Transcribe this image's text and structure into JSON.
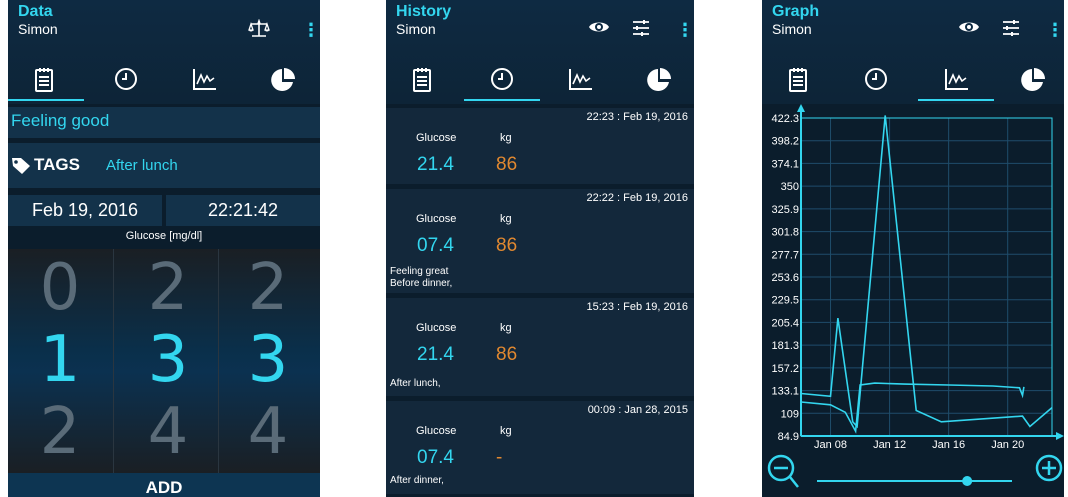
{
  "colors": {
    "accent": "#33d6ef",
    "weight": "#e08830",
    "bg": "#0b1d2c"
  },
  "screen_data": {
    "title": "Data",
    "user": "Simon",
    "actions": [
      "scale-icon",
      "more-vert-icon"
    ],
    "feeling": "Feeling good",
    "tags_label": "TAGS",
    "tags_value": "After lunch",
    "date": "Feb 19, 2016",
    "time": "22:21:42",
    "unit_label": "Glucose  [mg/dl]",
    "wheels": [
      {
        "above": "0",
        "selected": "1",
        "below": "2"
      },
      {
        "above": "2",
        "selected": "3",
        "below": "4"
      },
      {
        "above": "2",
        "selected": "3",
        "below": "4"
      }
    ],
    "add_label": "ADD"
  },
  "screen_history": {
    "title": "History",
    "user": "Simon",
    "actions": [
      "eye-icon",
      "filter-icon",
      "more-vert-icon"
    ],
    "entries": [
      {
        "timestamp": "22:23 : Feb 19, 2016",
        "glucose_label": "Glucose",
        "kg_label": "kg",
        "glucose": "21.4",
        "kg": "86",
        "notes": []
      },
      {
        "timestamp": "22:22 : Feb 19, 2016",
        "glucose_label": "Glucose",
        "kg_label": "kg",
        "glucose": "07.4",
        "kg": "86",
        "notes": [
          "Feeling great",
          "Before dinner,"
        ]
      },
      {
        "timestamp": "15:23 : Feb 19, 2016",
        "glucose_label": "Glucose",
        "kg_label": "kg",
        "glucose": "21.4",
        "kg": "86",
        "notes": [
          "After lunch,"
        ]
      },
      {
        "timestamp": "00:09 : Jan 28, 2015",
        "glucose_label": "Glucose",
        "kg_label": "kg",
        "glucose": "07.4",
        "kg": "-",
        "notes": [
          "After dinner,"
        ]
      }
    ]
  },
  "screen_graph": {
    "title": "Graph",
    "user": "Simon",
    "actions": [
      "eye-icon",
      "filter-icon",
      "more-vert-icon"
    ],
    "zoom": {
      "out_icon": "zoom-out-icon",
      "in_icon": "zoom-in-icon",
      "level": 0.77
    }
  },
  "tabs": [
    "notebook-icon",
    "clock-icon",
    "graph-icon",
    "pie-chart-icon"
  ],
  "chart_data": {
    "type": "line",
    "y_ticks": [
      "422.3",
      "398.2",
      "374.1",
      "350",
      "325.9",
      "301.8",
      "277.7",
      "253.6",
      "229.5",
      "205.4",
      "181.3",
      "157.2",
      "133.1",
      "109",
      "84.9"
    ],
    "x_ticks": [
      "Jan 08",
      "Jan 12",
      "Jan 16",
      "Jan 20"
    ],
    "ylim": [
      84.9,
      422.3
    ],
    "xlim": [
      "Jan 06",
      "Jan 23"
    ],
    "grid": true,
    "series": [
      {
        "points": [
          [
            "Jan 06",
            130
          ],
          [
            "Jan 08",
            127
          ],
          [
            "Jan 08.5",
            210
          ],
          [
            "Jan 09.5",
            100
          ],
          [
            "Jan 09.8",
            95
          ],
          [
            "Jan 11.7",
            425
          ],
          [
            "Jan 13.8",
            112
          ],
          [
            "Jan 15.5",
            100
          ],
          [
            "Jan 21",
            106
          ],
          [
            "Jan 21.5",
            95
          ],
          [
            "Jan 23",
            115
          ]
        ]
      },
      {
        "points": [
          [
            "Jan 06",
            121
          ],
          [
            "Jan 08",
            118
          ],
          [
            "Jan 09",
            110
          ],
          [
            "Jan 09.7",
            90
          ],
          [
            "Jan 10",
            139
          ],
          [
            "Jan 11",
            141
          ],
          [
            "Jan 13",
            140
          ],
          [
            "Jan 16",
            139
          ],
          [
            "Jan 19",
            138
          ],
          [
            "Jan 20.8",
            136
          ],
          [
            "Jan 21",
            128
          ],
          [
            "Jan 21.1",
            137
          ]
        ]
      }
    ]
  }
}
